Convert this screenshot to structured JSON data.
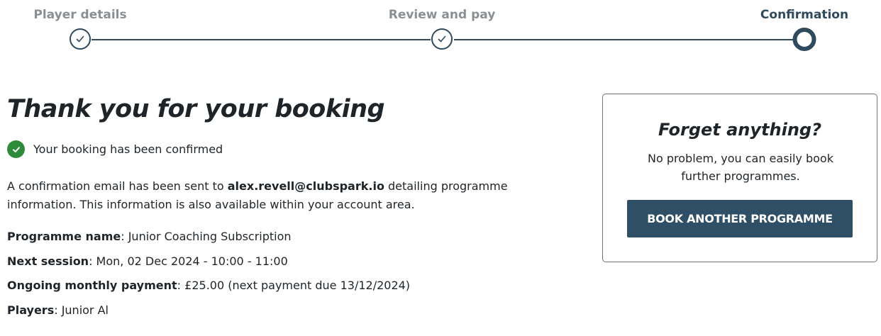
{
  "stepper": {
    "steps": [
      {
        "label": "Player details",
        "state": "complete"
      },
      {
        "label": "Review and pay",
        "state": "complete"
      },
      {
        "label": "Confirmation",
        "state": "current"
      }
    ]
  },
  "main": {
    "title": "Thank you for your booking",
    "confirmed_text": "Your booking has been confirmed",
    "email_intro": "A confirmation email has been sent to ",
    "email": "alex.revell@clubspark.io",
    "email_outro": " detailing programme information. This information is also available within your account area.",
    "details": [
      {
        "key": "Programme name",
        "value": ": Junior Coaching Subscription"
      },
      {
        "key": "Next session",
        "value": ": Mon, 02 Dec 2024 - 10:00 - 11:00"
      },
      {
        "key": "Ongoing monthly payment",
        "value": ": £25.00 (next payment due 13/12/2024)"
      },
      {
        "key": "Players",
        "value": ": Junior Al"
      }
    ]
  },
  "card": {
    "title": "Forget anything?",
    "text": "No problem, you can easily book further programmes.",
    "button_label": "BOOK ANOTHER PROGRAMME"
  },
  "colors": {
    "accent": "#2f4a5c",
    "button": "#2f4f66",
    "success": "#2e8b3a",
    "muted_label": "#8a8f93"
  },
  "icons": {
    "step_complete": "check-icon",
    "confirmed": "check-circle-icon"
  }
}
